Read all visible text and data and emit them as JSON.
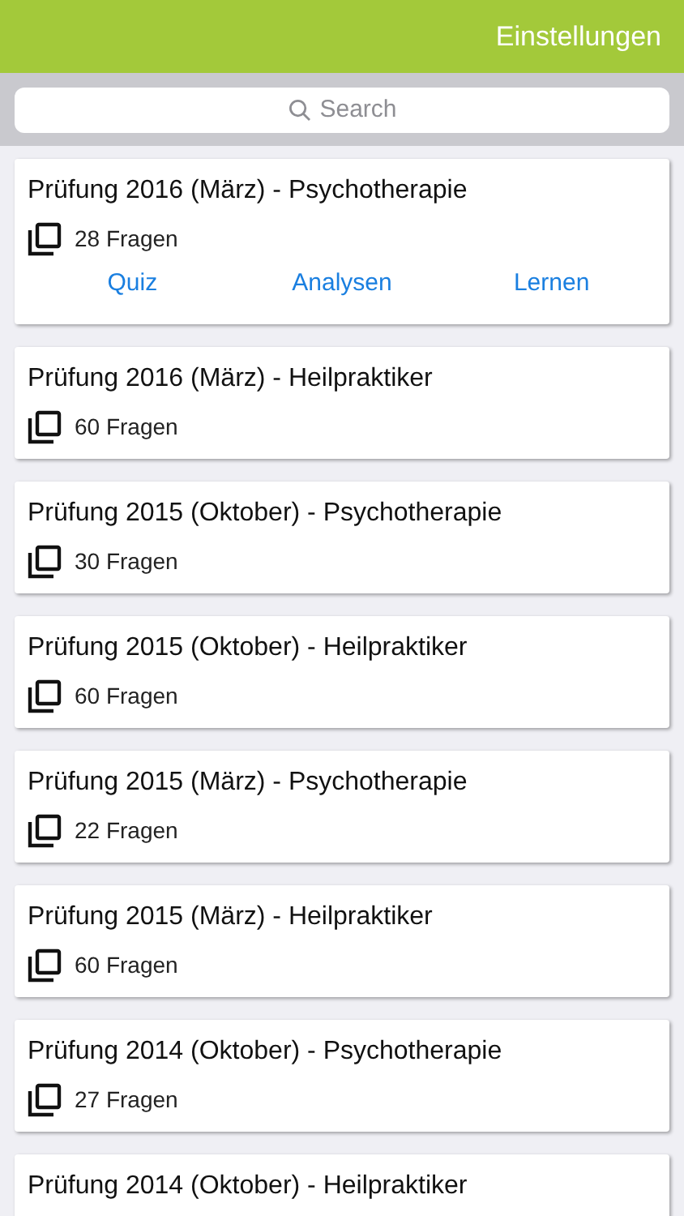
{
  "header": {
    "settings_link": "Einstellungen"
  },
  "search": {
    "placeholder": "Search"
  },
  "exams": [
    {
      "title": "Prüfung 2016 (März) - Psychotherapie",
      "count": "28 Fragen",
      "expanded": true,
      "actions": [
        "Quiz",
        "Analysen",
        "Lernen"
      ]
    },
    {
      "title": "Prüfung 2016 (März) - Heilpraktiker",
      "count": "60 Fragen"
    },
    {
      "title": "Prüfung 2015 (Oktober) - Psychotherapie",
      "count": "30 Fragen"
    },
    {
      "title": "Prüfung 2015 (Oktober) - Heilpraktiker",
      "count": "60 Fragen"
    },
    {
      "title": "Prüfung 2015 (März) - Psychotherapie",
      "count": "22 Fragen"
    },
    {
      "title": "Prüfung 2015 (März) - Heilpraktiker",
      "count": "60 Fragen"
    },
    {
      "title": "Prüfung 2014 (Oktober) - Psychotherapie",
      "count": "27 Fragen"
    },
    {
      "title": "Prüfung 2014 (Oktober) - Heilpraktiker"
    }
  ]
}
